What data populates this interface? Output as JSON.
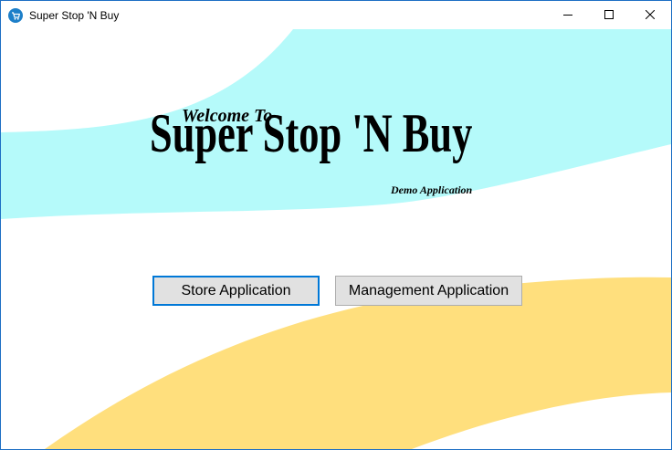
{
  "window": {
    "title": "Super Stop 'N Buy",
    "app_icon": "cart-icon",
    "controls": {
      "minimize_icon": "minimize-icon",
      "maximize_icon": "maximize-icon",
      "close_icon": "close-icon"
    }
  },
  "splash": {
    "welcome": "Welcome To",
    "title": "Super Stop 'N Buy",
    "subtitle": "Demo Application"
  },
  "buttons": {
    "store": "Store Application",
    "management": "Management Application"
  },
  "colors": {
    "cyan_band": "#b5fafa",
    "yellow_band": "#ffdf7d",
    "focus_border": "#0078d7",
    "button_face": "#e1e1e1",
    "window_border": "#1e6fc4"
  }
}
